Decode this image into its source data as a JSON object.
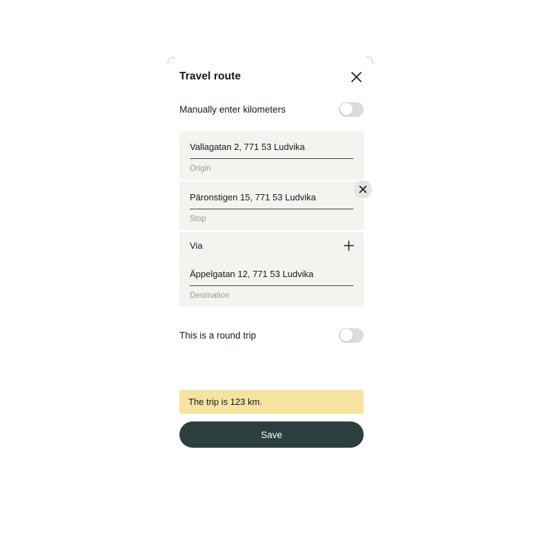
{
  "modal": {
    "title": "Travel route",
    "close_icon": "close-icon"
  },
  "manual_toggle": {
    "label": "Manually enter kilometers",
    "state": "off"
  },
  "route": {
    "fields": [
      {
        "value": "Vallagatan 2, 771 53 Ludvika",
        "label": "Origin",
        "removable": false
      },
      {
        "value": "Päronstigen 15, 771 53 Ludvika",
        "label": "Stop",
        "removable": true,
        "remove_icon": "close-icon"
      },
      {
        "value": "Äppelgatan 12, 771 53 Ludvika",
        "label": "Destination",
        "removable": false
      }
    ],
    "add_via": {
      "label": "Via",
      "icon": "plus-icon"
    }
  },
  "round_trip_toggle": {
    "label": "This is a round trip",
    "state": "off"
  },
  "info_banner": {
    "text": "The trip is 123 km."
  },
  "save_button": {
    "label": "Save"
  },
  "colors": {
    "accent_dark": "#2b3f3f",
    "banner_yellow": "#f6e3a0",
    "field_background": "#f4f3f0",
    "switch_track": "#dcdcdc",
    "remove_button": "#e4e4e4",
    "text_primary": "#14181a",
    "label_grey": "#9a9790"
  }
}
